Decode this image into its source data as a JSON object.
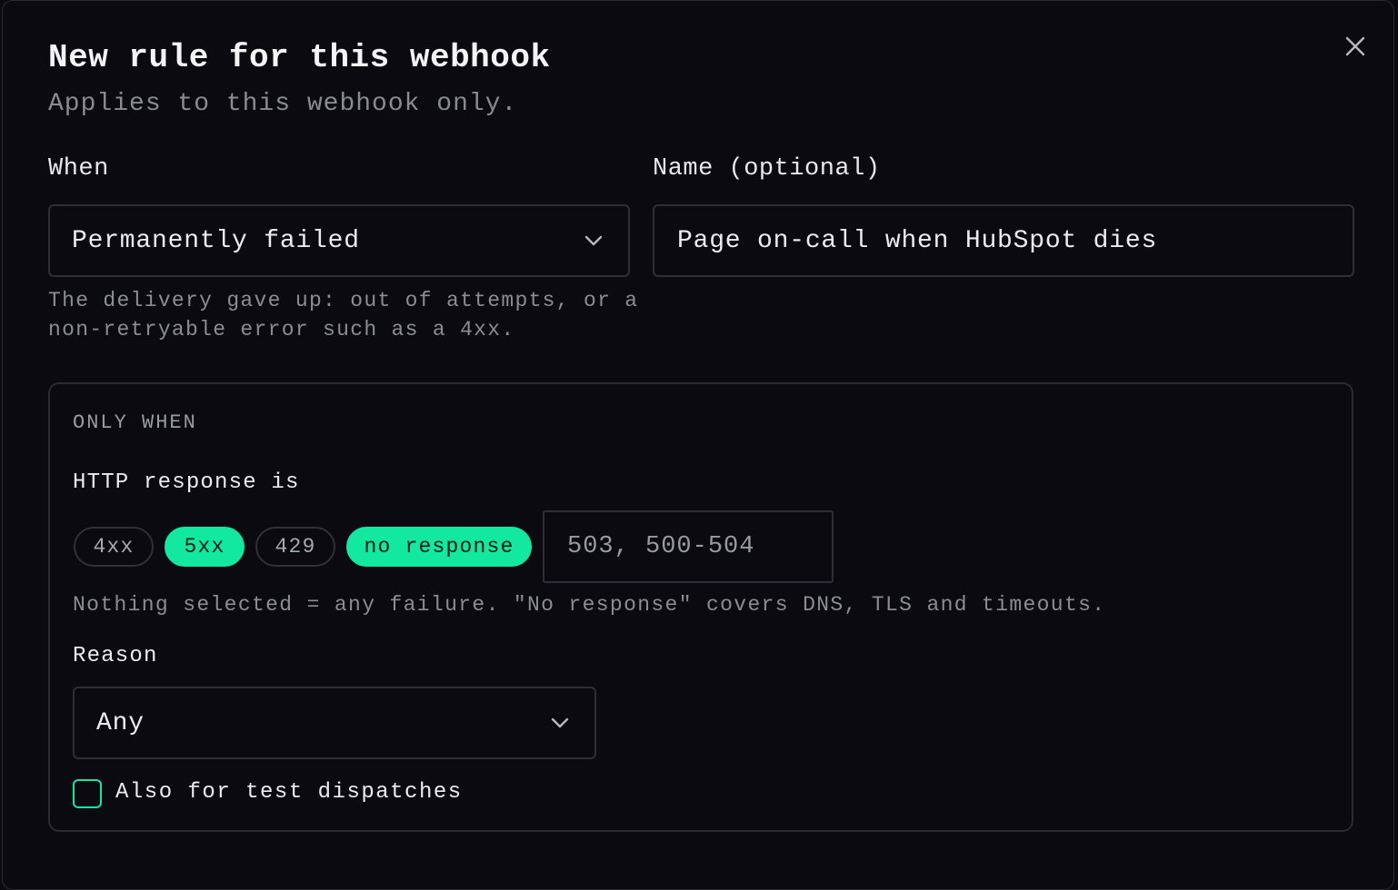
{
  "dialog": {
    "title": "New rule for this webhook",
    "subtitle": "Applies to this webhook only.",
    "close_icon": "close-icon"
  },
  "when": {
    "label": "When",
    "value": "Permanently failed",
    "help_line1": "The delivery gave up: out of attempts, or a",
    "help_line2": "non-retryable error such as a 4xx."
  },
  "name": {
    "label": "Name (optional)",
    "value": "Page on-call when HubSpot dies"
  },
  "only_when": {
    "title": "ONLY WHEN",
    "http_label": "HTTP response is",
    "chips": [
      {
        "label": "4xx",
        "selected": false
      },
      {
        "label": "5xx",
        "selected": true
      },
      {
        "label": "429",
        "selected": false
      },
      {
        "label": "no response",
        "selected": true
      }
    ],
    "codes_placeholder": "503, 500-504",
    "help": "Nothing selected = any failure. \"No response\" covers DNS, TLS and timeouts.",
    "reason_label": "Reason",
    "reason_value": "Any",
    "test_dispatch_label": "Also for test dispatches",
    "test_dispatch_checked": false
  },
  "colors": {
    "accent": "#12e8a0",
    "background": "#0a0a10",
    "border": "#2e2e36"
  }
}
